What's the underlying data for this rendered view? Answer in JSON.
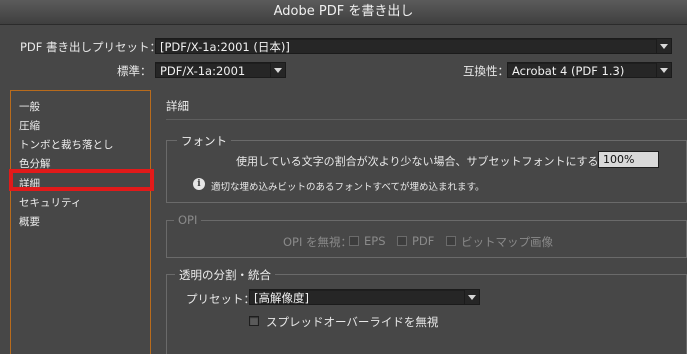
{
  "window": {
    "title": "Adobe PDF を書き出し"
  },
  "top": {
    "preset_label": "PDF 書き出しプリセット：",
    "preset_value": "[PDF/X-1a:2001 (日本)]",
    "standard_label": "標準：",
    "standard_value": "PDF/X-1a:2001",
    "compat_label": "互換性：",
    "compat_value": "Acrobat 4 (PDF 1.3)"
  },
  "sidebar": {
    "items": [
      {
        "label": "一般"
      },
      {
        "label": "圧縮"
      },
      {
        "label": "トンボと裁ち落とし"
      },
      {
        "label": "色分解"
      },
      {
        "label": "詳細"
      },
      {
        "label": "セキュリティ"
      },
      {
        "label": "概要"
      }
    ],
    "selected": "詳細"
  },
  "main": {
    "title": "詳細",
    "font": {
      "title": "フォント",
      "subset_label": "使用している文字の割合が次より少ない場合、サブセットフォントにする：",
      "subset_value": "100%",
      "info": "適切な埋め込みビットのあるフォントすべてが埋め込まれます。"
    },
    "opi": {
      "title": "OPI",
      "omit_label": "OPI を無視：",
      "eps": "EPS",
      "pdf": "PDF",
      "bitmap": "ビットマップ画像"
    },
    "flatten": {
      "title": "透明の分割・統合",
      "preset_label": "プリセット：",
      "preset_value": "[高解像度]",
      "ignore_spread": "スプレッドオーバーライドを無視"
    }
  },
  "colors": {
    "highlight": "#e21a1a",
    "sidebar_border": "#b86b1c",
    "background": "#474747"
  }
}
